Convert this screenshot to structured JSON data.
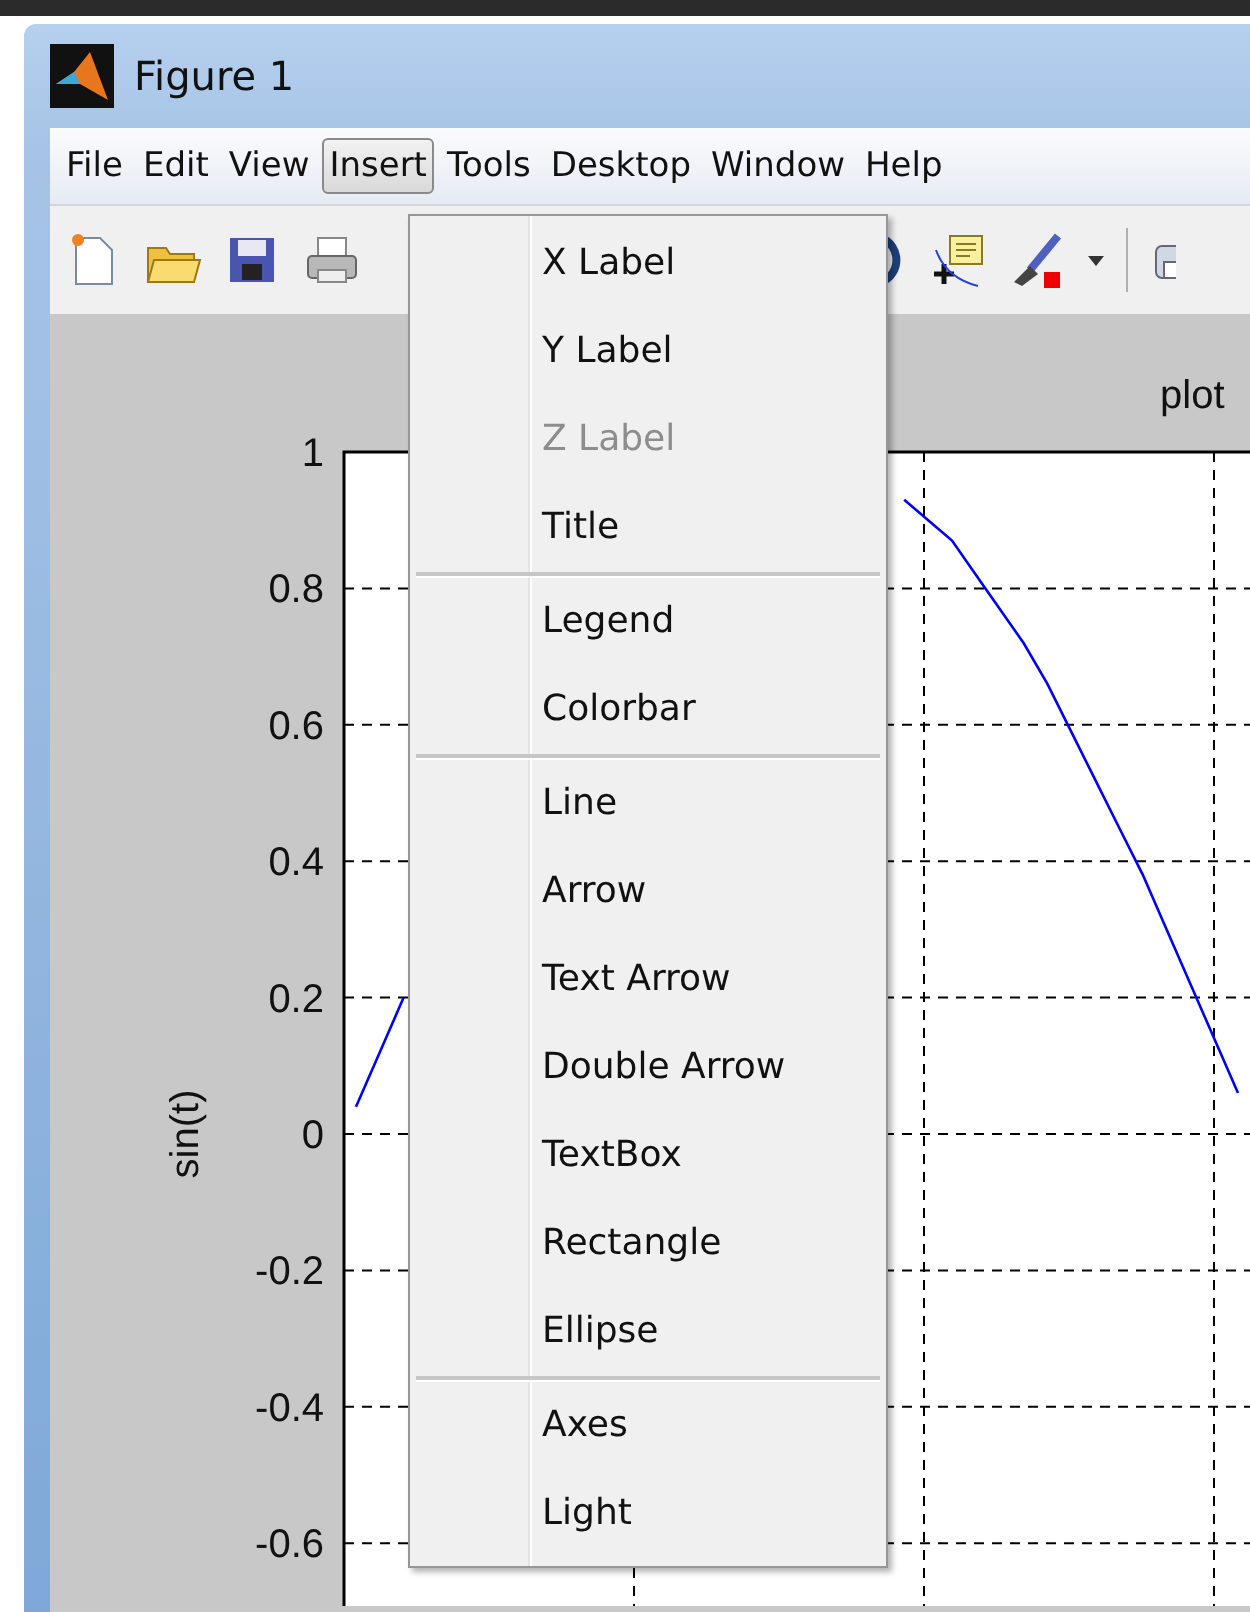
{
  "window": {
    "title": "Figure 1"
  },
  "menu_bar": [
    {
      "label": "File",
      "selected": false
    },
    {
      "label": "Edit",
      "selected": false
    },
    {
      "label": "View",
      "selected": false
    },
    {
      "label": "Insert",
      "selected": true
    },
    {
      "label": "Tools",
      "selected": false
    },
    {
      "label": "Desktop",
      "selected": false
    },
    {
      "label": "Window",
      "selected": false
    },
    {
      "label": "Help",
      "selected": false
    }
  ],
  "insert_menu": {
    "groups": [
      {
        "items": [
          {
            "label": "X Label",
            "disabled": false
          },
          {
            "label": "Y Label",
            "disabled": false
          },
          {
            "label": "Z Label",
            "disabled": true
          },
          {
            "label": "Title",
            "disabled": false
          }
        ]
      },
      {
        "items": [
          {
            "label": "Legend",
            "disabled": false
          },
          {
            "label": "Colorbar",
            "disabled": false
          }
        ]
      },
      {
        "items": [
          {
            "label": "Line",
            "disabled": false
          },
          {
            "label": "Arrow",
            "disabled": false
          },
          {
            "label": "Text Arrow",
            "disabled": false
          },
          {
            "label": "Double Arrow",
            "disabled": false
          },
          {
            "label": "TextBox",
            "disabled": false
          },
          {
            "label": "Rectangle",
            "disabled": false
          },
          {
            "label": "Ellipse",
            "disabled": false
          }
        ]
      },
      {
        "items": [
          {
            "label": "Axes",
            "disabled": false
          },
          {
            "label": "Light",
            "disabled": false
          }
        ]
      }
    ]
  },
  "axes": {
    "chart_data": {
      "type": "line",
      "title": "plot",
      "ylabel": "sin(t)",
      "ylim": [
        -0.76,
        1
      ],
      "grid": true,
      "yticks": [
        {
          "value": 1,
          "label": "1"
        },
        {
          "value": 0.8,
          "label": "0.8"
        },
        {
          "value": 0.6,
          "label": "0.6"
        },
        {
          "value": 0.4,
          "label": "0.4"
        },
        {
          "value": 0.2,
          "label": "0.2"
        },
        {
          "value": 0,
          "label": "0"
        },
        {
          "value": -0.2,
          "label": "-0.2"
        },
        {
          "value": -0.4,
          "label": "-0.4"
        },
        {
          "value": -0.6,
          "label": "-0.6"
        }
      ],
      "series": [
        {
          "color": "#0000ff",
          "values": [
            0.04,
            0.12,
            0.2,
            null,
            null,
            null,
            null,
            null,
            null,
            null,
            null,
            null,
            null,
            null,
            null,
            null,
            null,
            null,
            null,
            null,
            null,
            null,
            null,
            0.93,
            0.9,
            0.87,
            0.82,
            0.77,
            0.72,
            0.66,
            0.59,
            0.52,
            0.45,
            0.38,
            0.3,
            0.22,
            0.14,
            0.06
          ]
        }
      ]
    }
  }
}
